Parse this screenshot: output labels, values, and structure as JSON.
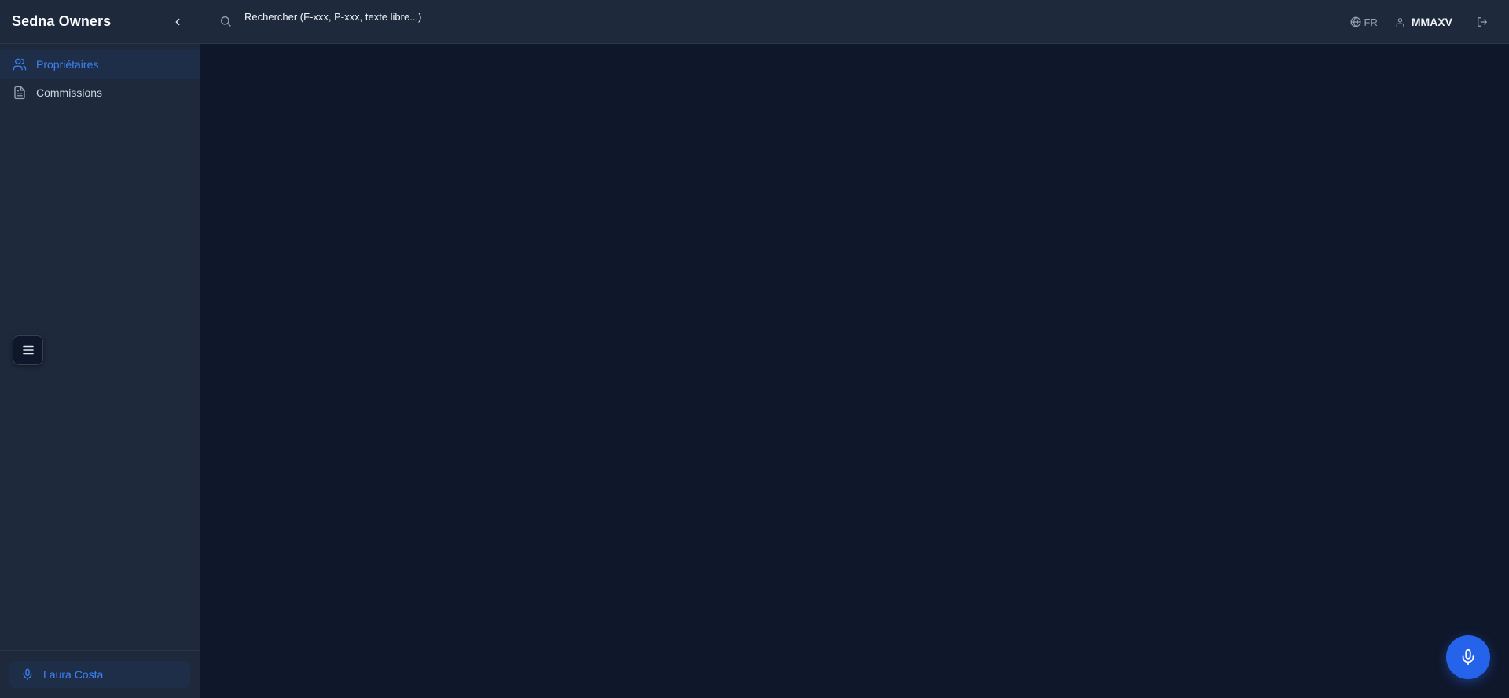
{
  "sidebar": {
    "brand": "Sedna Owners",
    "items": [
      {
        "label": "Propriétaires",
        "icon": "users-icon",
        "active": true
      },
      {
        "label": "Commissions",
        "icon": "document-icon",
        "active": false
      }
    ],
    "footer_user": "Laura Costa"
  },
  "topbar": {
    "search_placeholder": "Rechercher (F-xxx, P-xxx, texte libre...)",
    "language": "FR",
    "username": "MMAXV"
  },
  "colors": {
    "accent": "#3b82f6",
    "fab": "#2563eb",
    "sidebar_bg": "#1e293b",
    "main_bg": "#0f172a"
  }
}
